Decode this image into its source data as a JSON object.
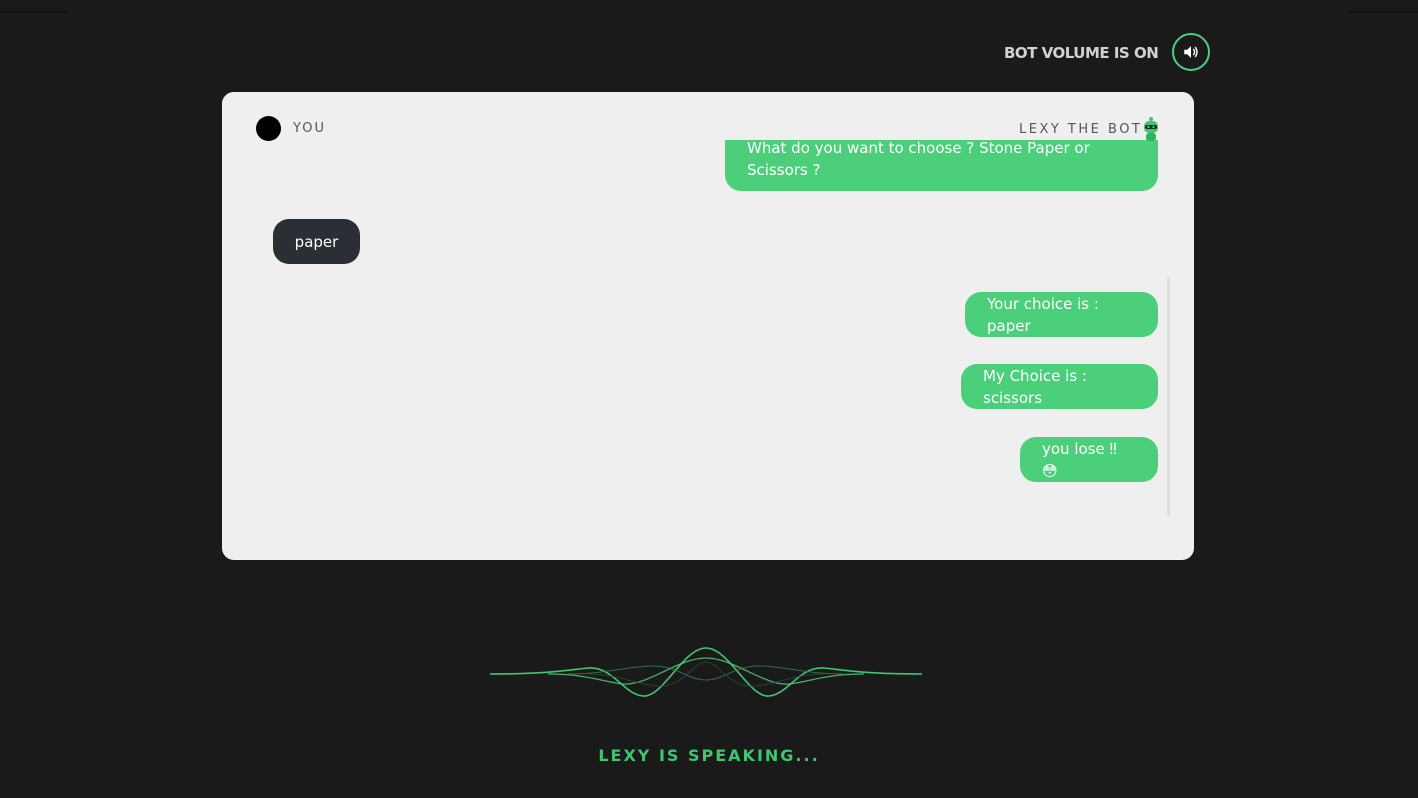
{
  "header": {
    "volume_label": "BOT VOLUME IS ON",
    "volume_icon": "speaker-volume-icon"
  },
  "chat": {
    "user_label": "YOU",
    "bot_label": "LEXY THE BOT",
    "messages": [
      {
        "from": "bot",
        "text": "What do you want to choose ? Stone Paper or Scissors ?"
      },
      {
        "from": "user",
        "text": "paper"
      },
      {
        "from": "bot",
        "text": "Your choice is : paper"
      },
      {
        "from": "bot",
        "text": "My Choice is : scissors"
      },
      {
        "from": "bot",
        "text": "you lose ‼ 😳"
      }
    ]
  },
  "status": {
    "text": "LEXY IS SPEAKING..."
  },
  "colors": {
    "accent": "#4ccf7a",
    "background": "#1a1a1a",
    "card": "#efefef",
    "user_bubble": "#2b2e34"
  }
}
